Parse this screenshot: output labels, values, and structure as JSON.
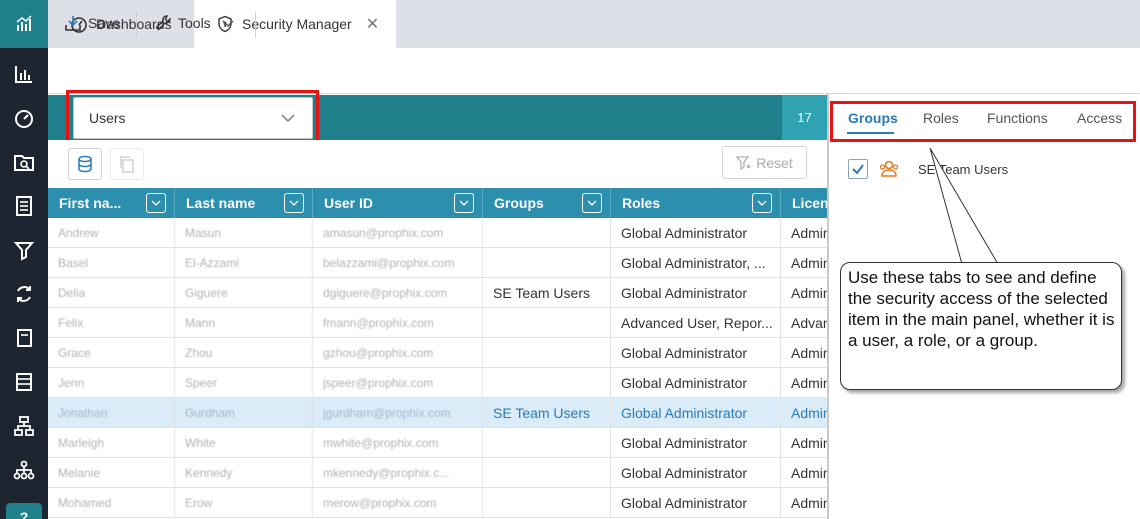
{
  "tabs": [
    {
      "label": "Dashboards",
      "icon": "gauge-icon"
    },
    {
      "label": "Security Manager",
      "icon": "shield-icon",
      "closable": true
    }
  ],
  "toolbar": {
    "save_label": "Save",
    "tools_label": "Tools"
  },
  "main": {
    "selector_value": "Users",
    "count": "17",
    "reset_label": "Reset",
    "columns": [
      "First na...",
      "Last name",
      "User ID",
      "Groups",
      "Roles",
      "Licens"
    ],
    "rows": [
      {
        "first": "Andrew",
        "last": "Masun",
        "userid": "amasun@prophix.com",
        "groups": "",
        "roles": "Global Administrator",
        "license": "Admin"
      },
      {
        "first": "Basel",
        "last": "El-Azzami",
        "userid": "belazzami@prophix.com",
        "groups": "",
        "roles": "Global Administrator, ...",
        "license": "Admin"
      },
      {
        "first": "Delia",
        "last": "Giguere",
        "userid": "dgiguere@prophix.com",
        "groups": "SE Team Users",
        "roles": "Global Administrator",
        "license": "Admin"
      },
      {
        "first": "Felix",
        "last": "Mann",
        "userid": "fmann@prophix.com",
        "groups": "",
        "roles": "Advanced User, Repor...",
        "license": "Advan"
      },
      {
        "first": "Grace",
        "last": "Zhou",
        "userid": "gzhou@prophix.com",
        "groups": "",
        "roles": "Global Administrator",
        "license": "Admin"
      },
      {
        "first": "Jenn",
        "last": "Speer",
        "userid": "jspeer@prophix.com",
        "groups": "",
        "roles": "Global Administrator",
        "license": "Admin"
      },
      {
        "first": "Jonathan",
        "last": "Gurdham",
        "userid": "jgurdham@prophix.com",
        "groups": "SE Team Users",
        "roles": "Global Administrator",
        "license": "Admin",
        "selected": true
      },
      {
        "first": "Marleigh",
        "last": "White",
        "userid": "mwhite@prophix.com",
        "groups": "",
        "roles": "Global Administrator",
        "license": "Admin"
      },
      {
        "first": "Melanie",
        "last": "Kennedy",
        "userid": "mkennedy@prophix.c...",
        "groups": "",
        "roles": "Global Administrator",
        "license": "Admin"
      },
      {
        "first": "Mohamed",
        "last": "Erow",
        "userid": "merow@prophix.com",
        "groups": "",
        "roles": "Global Administrator",
        "license": "Admin"
      }
    ]
  },
  "right_panel": {
    "tabs": [
      "Groups",
      "Roles",
      "Functions",
      "Access"
    ],
    "active_tab": "Groups",
    "items": [
      {
        "label": "SE Team Users",
        "checked": true
      }
    ]
  },
  "callout": {
    "text": "Use these tabs to see and define the security access of the selected item in the main panel, whether it is a user, a role, or a group."
  },
  "rail_bottom_label": "?",
  "colors": {
    "accent": "#1f7f8a",
    "grid_header": "#2d8fae",
    "highlight": "#e81212",
    "link_blue": "#2a79b8",
    "rail": "#1d2630"
  }
}
